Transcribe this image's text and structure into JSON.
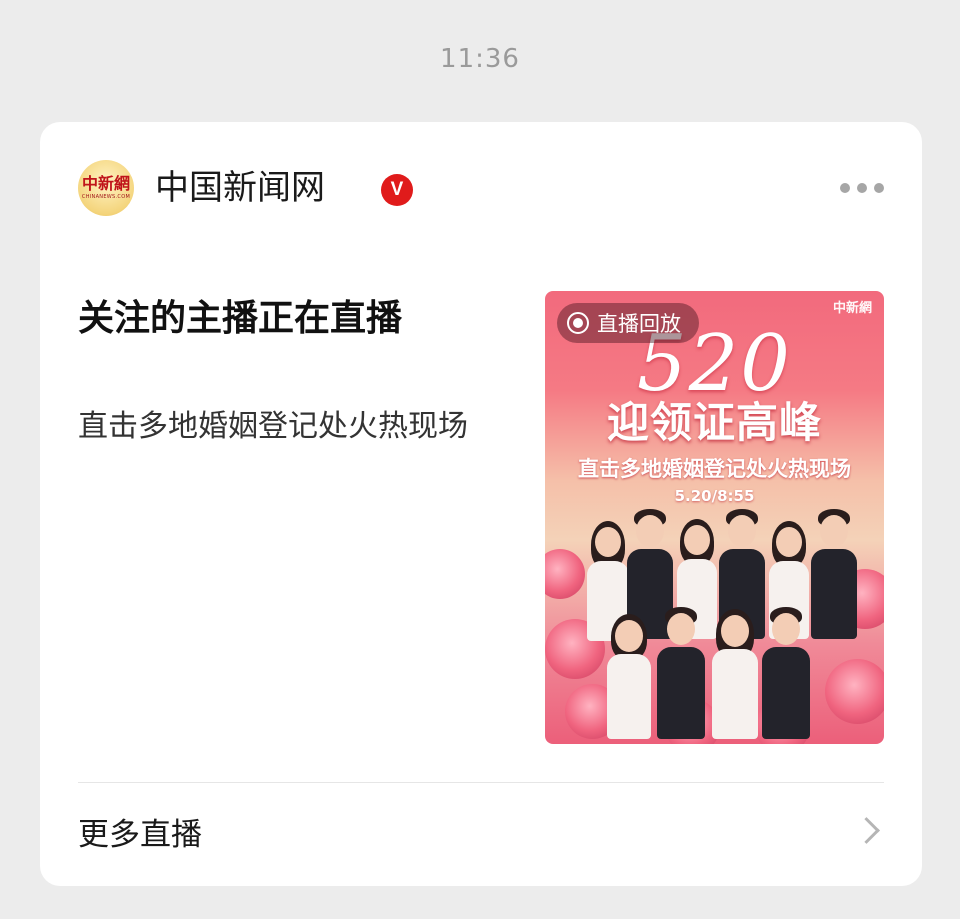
{
  "status_time": "11:36",
  "account": {
    "name": "中国新闻网",
    "verified_mark": "V",
    "avatar_logo_text": "中新網",
    "avatar_logo_sub": "CHINANEWS.COM"
  },
  "content": {
    "title": "关注的主播正在直播",
    "description": "直击多地婚姻登记处火热现场"
  },
  "thumbnail": {
    "badge_label": "直播回放",
    "poster_logo": "中新網",
    "poster_big_number": "520",
    "poster_headline": "迎领证高峰",
    "poster_subline": "直击多地婚姻登记处火热现场",
    "poster_date": "5.20/8:55"
  },
  "footer": {
    "more_label": "更多直播"
  },
  "colors": {
    "background": "#ececec",
    "card": "#ffffff",
    "verified_badge": "#e01b1b",
    "poster_pink": "#f26a7d"
  },
  "icons": [
    "more-horizontal-icon",
    "verified-icon",
    "record-icon",
    "chevron-right-icon"
  ]
}
